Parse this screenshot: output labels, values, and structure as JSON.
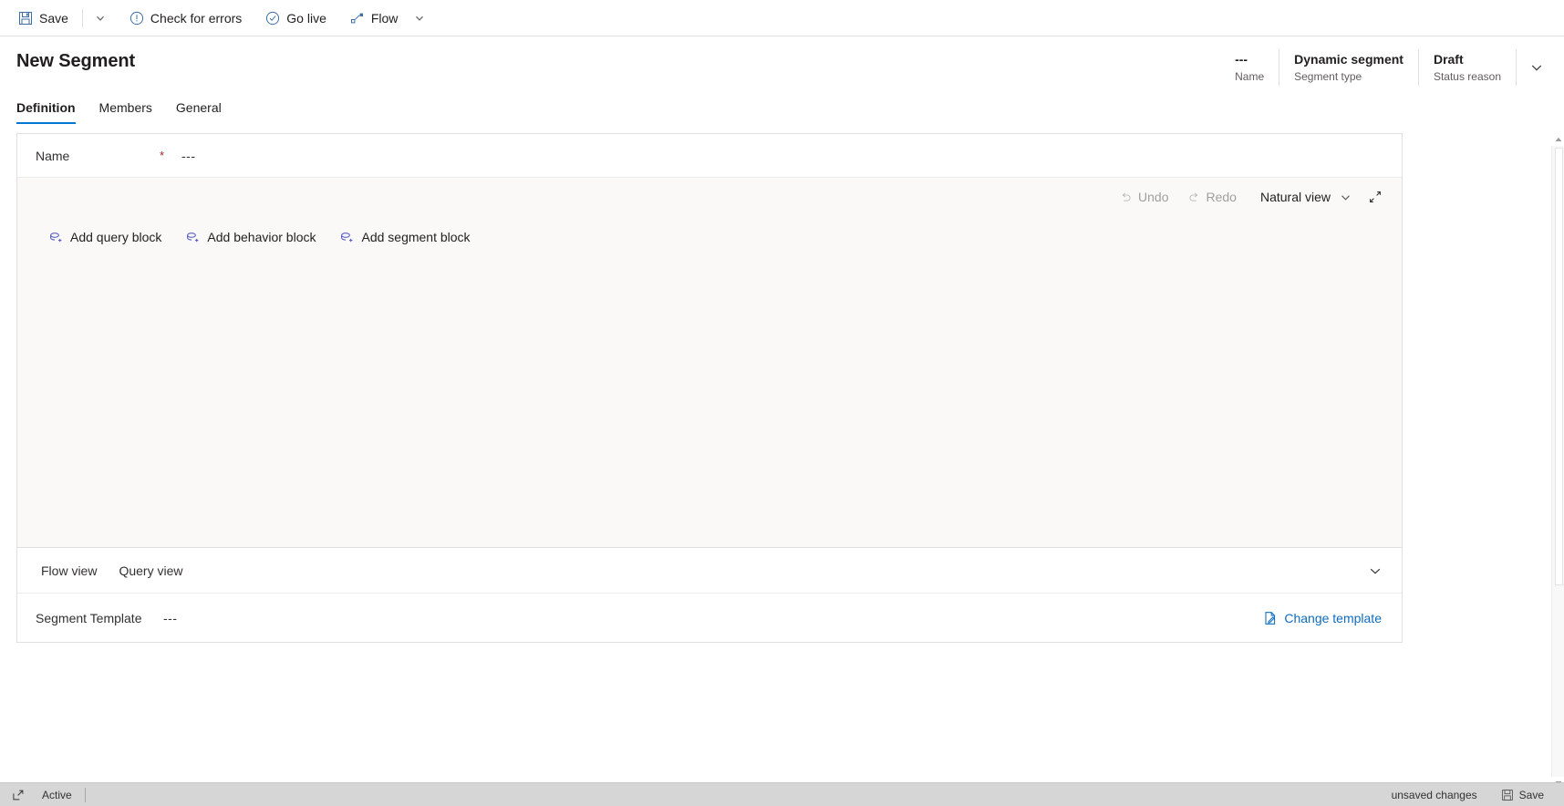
{
  "commandbar": {
    "save_label": "Save",
    "save_icon": "save-floppy-icon",
    "save_caret_icon": "chevron-down-icon",
    "check_errors_label": "Check for errors",
    "check_errors_icon": "exclamation-circle-icon",
    "go_live_label": "Go live",
    "go_live_icon": "checkmark-circle-icon",
    "flow_label": "Flow",
    "flow_icon": "flow-node-icon",
    "flow_caret_icon": "chevron-down-icon"
  },
  "header": {
    "title": "New Segment",
    "fields": [
      {
        "value": "---",
        "label": "Name"
      },
      {
        "value": "Dynamic segment",
        "label": "Segment type"
      },
      {
        "value": "Draft",
        "label": "Status reason"
      }
    ],
    "expand_icon": "chevron-down-icon"
  },
  "tabs": [
    {
      "label": "Definition",
      "active": true
    },
    {
      "label": "Members",
      "active": false
    },
    {
      "label": "General",
      "active": false
    }
  ],
  "form": {
    "name_label": "Name",
    "required_marker": "*",
    "name_value": "---"
  },
  "canvas": {
    "toolbar": {
      "undo_label": "Undo",
      "undo_icon": "undo-arrow-icon",
      "undo_disabled": true,
      "redo_label": "Redo",
      "redo_icon": "redo-arrow-icon",
      "redo_disabled": true,
      "view_mode_label": "Natural view",
      "view_mode_caret_icon": "chevron-down-icon",
      "expand_icon": "expand-diagonal-icon"
    },
    "blocks": [
      {
        "label": "Add query block",
        "icon": "add-query-block-icon"
      },
      {
        "label": "Add behavior block",
        "icon": "add-behavior-block-icon"
      },
      {
        "label": "Add segment block",
        "icon": "add-segment-block-icon"
      }
    ]
  },
  "viewbar": {
    "tabs": [
      {
        "label": "Flow view"
      },
      {
        "label": "Query view"
      }
    ],
    "collapse_icon": "chevron-down-icon"
  },
  "template": {
    "label": "Segment Template",
    "value": "---",
    "change_label": "Change template",
    "change_icon": "edit-document-icon"
  },
  "statusbar": {
    "popout_icon": "popout-window-icon",
    "state_label": "Active",
    "unsaved_label": "unsaved changes",
    "save_label": "Save",
    "save_icon": "save-floppy-icon"
  },
  "colors": {
    "accent": "#0078d4",
    "link": "#0f6cbd",
    "required": "#a4262c",
    "block_icon": "#5b5fc7",
    "canvas_bg": "#faf9f8",
    "statusbar_bg": "#d6d6d6"
  }
}
